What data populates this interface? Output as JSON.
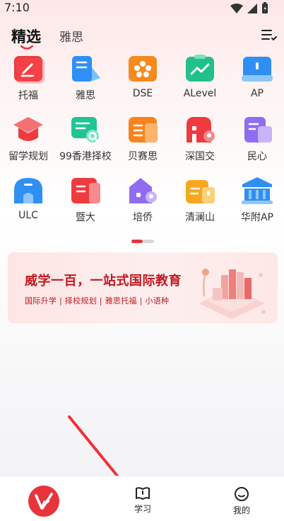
{
  "status": {
    "time": "7:10"
  },
  "header": {
    "tab_active": "精选",
    "tab_inactive": "雅思"
  },
  "grid": {
    "items": [
      {
        "label": "托福",
        "icon": "toefl-pen-icon",
        "color": "#f0373d"
      },
      {
        "label": "雅思",
        "icon": "ielts-book-icon",
        "color": "#2e8ff5"
      },
      {
        "label": "DSE",
        "icon": "hk-flower-icon",
        "color": "#f58a1e"
      },
      {
        "label": "ALevel",
        "icon": "chart-trend-icon",
        "color": "#22c08a"
      },
      {
        "label": "AP",
        "icon": "open-book-icon",
        "color": "#2f8ff3"
      },
      {
        "label": "留学规划",
        "icon": "graduation-cap-icon",
        "color": "#ef3a3f"
      },
      {
        "label": "99香港择校",
        "icon": "school-search-icon",
        "color": "#21c493"
      },
      {
        "label": "贝赛思",
        "icon": "building-icon",
        "color": "#f7841f"
      },
      {
        "label": "深国交",
        "icon": "school-location-icon",
        "color": "#ef3a3f"
      },
      {
        "label": "民心",
        "icon": "building-doc-icon",
        "color": "#8f6cf2"
      },
      {
        "label": "ULC",
        "icon": "arch-building-icon",
        "color": "#2f8ff3"
      },
      {
        "label": "暨大",
        "icon": "university-icon",
        "color": "#ef3a3f"
      },
      {
        "label": "培侨",
        "icon": "house-location-icon",
        "color": "#8f6cf2"
      },
      {
        "label": "清澜山",
        "icon": "mountain-school-icon",
        "color": "#f7a81f"
      },
      {
        "label": "华附AP",
        "icon": "temple-icon",
        "color": "#2f8ff3"
      }
    ]
  },
  "banner": {
    "title": "威学一百，一站式国际教育",
    "subtitle": "国际升学 | 择校规划 | 雅思托福 | 小语种"
  },
  "bottom_nav": {
    "study_label": "学习",
    "me_label": "我的"
  },
  "colors": {
    "brand": "#e8343a"
  }
}
